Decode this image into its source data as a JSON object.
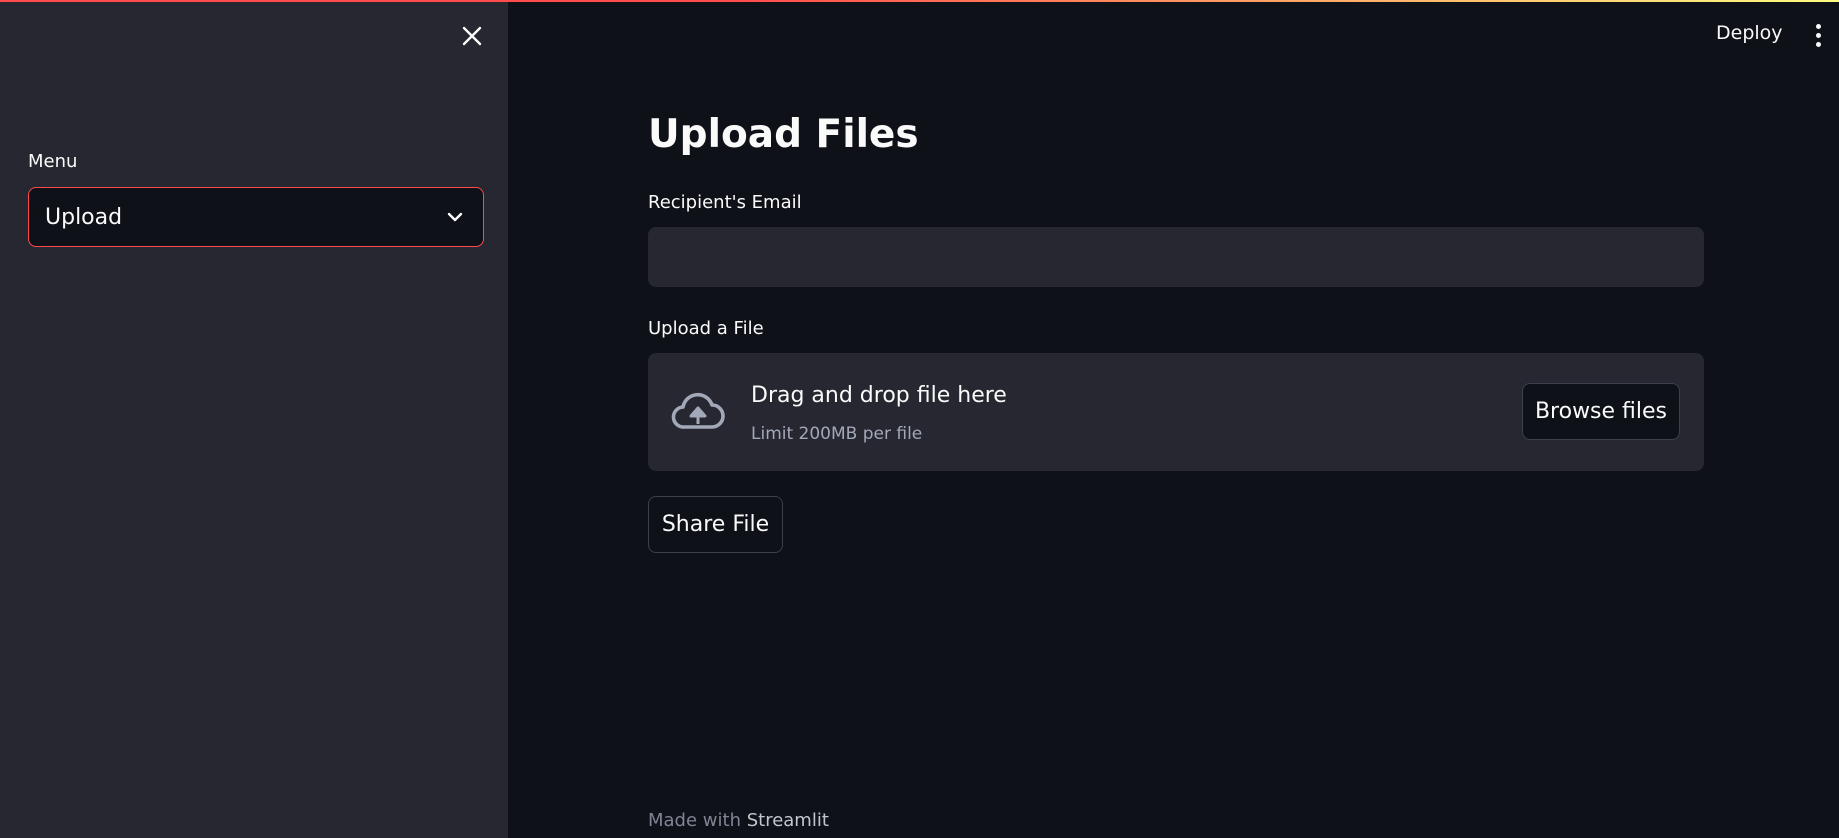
{
  "colors": {
    "background": "#0e1117",
    "sidebar": "#262730",
    "accent": "#ff4b4b",
    "input_bg": "#262730",
    "muted_text": "#a3a8b8"
  },
  "sidebar": {
    "close_icon": "close-icon",
    "menu_label": "Menu",
    "menu_selected": "Upload",
    "chevron_icon": "chevron-down-icon"
  },
  "header": {
    "deploy_label": "Deploy",
    "menu_icon": "more-vertical-icon"
  },
  "main": {
    "title": "Upload Files",
    "email_label": "Recipient's Email",
    "email_value": "",
    "upload_label": "Upload a File",
    "dropzone": {
      "icon": "cloud-upload-icon",
      "title": "Drag and drop file here",
      "limit": "Limit 200MB per file",
      "browse_label": "Browse files"
    },
    "share_label": "Share File"
  },
  "footer": {
    "prefix": "Made with",
    "link": "Streamlit"
  }
}
